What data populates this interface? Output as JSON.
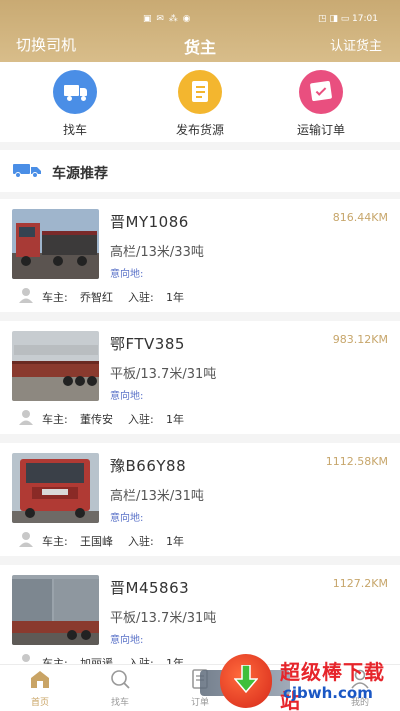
{
  "status_bar": {
    "left_icons": "▣ ✉ ⁂ ◉",
    "right_text": "◳ ◨ ▭ 17:01"
  },
  "nav": {
    "left": "切换司机",
    "title": "货主",
    "right": "认证货主"
  },
  "quick_actions": [
    {
      "label": "找车",
      "icon": "truck-icon",
      "color": "#4a8ee6"
    },
    {
      "label": "发布货源",
      "icon": "document-icon",
      "color": "#f3b62f"
    },
    {
      "label": "运输订单",
      "icon": "order-icon",
      "color": "#e94f7f"
    }
  ],
  "section": {
    "title": "车源推荐"
  },
  "cards": [
    {
      "plate": "晋MY1086",
      "distance": "816.44KM",
      "spec": "高栏/13米/33吨",
      "intent": "意向地:",
      "owner_label": "车主:",
      "owner": "乔智红",
      "join_label": "入驻:",
      "join": "1年"
    },
    {
      "plate": "鄂FTV385",
      "distance": "983.12KM",
      "spec": "平板/13.7米/31吨",
      "intent": "意向地:",
      "owner_label": "车主:",
      "owner": "董传安",
      "join_label": "入驻:",
      "join": "1年"
    },
    {
      "plate": "豫B66Y88",
      "distance": "1112.58KM",
      "spec": "高栏/13米/31吨",
      "intent": "意向地:",
      "owner_label": "车主:",
      "owner": "王国峰",
      "join_label": "入驻:",
      "join": "1年"
    },
    {
      "plate": "晋M45863",
      "distance": "1127.2KM",
      "spec": "平板/13.7米/31吨",
      "intent": "意向地:",
      "owner_label": "车主:",
      "owner": "加丽谖",
      "join_label": "入驻:",
      "join": "1年"
    }
  ],
  "tabs": [
    {
      "label": "首页",
      "active": true
    },
    {
      "label": "找车",
      "active": false
    },
    {
      "label": "订单",
      "active": false
    },
    {
      "label": "我的",
      "active": false
    }
  ],
  "watermark": {
    "title": "超级棒下载站",
    "url": "cjbwh.com"
  },
  "colors": {
    "header": "#c9aa73",
    "accent": "#c7a66b",
    "intent": "#5a72c8"
  }
}
